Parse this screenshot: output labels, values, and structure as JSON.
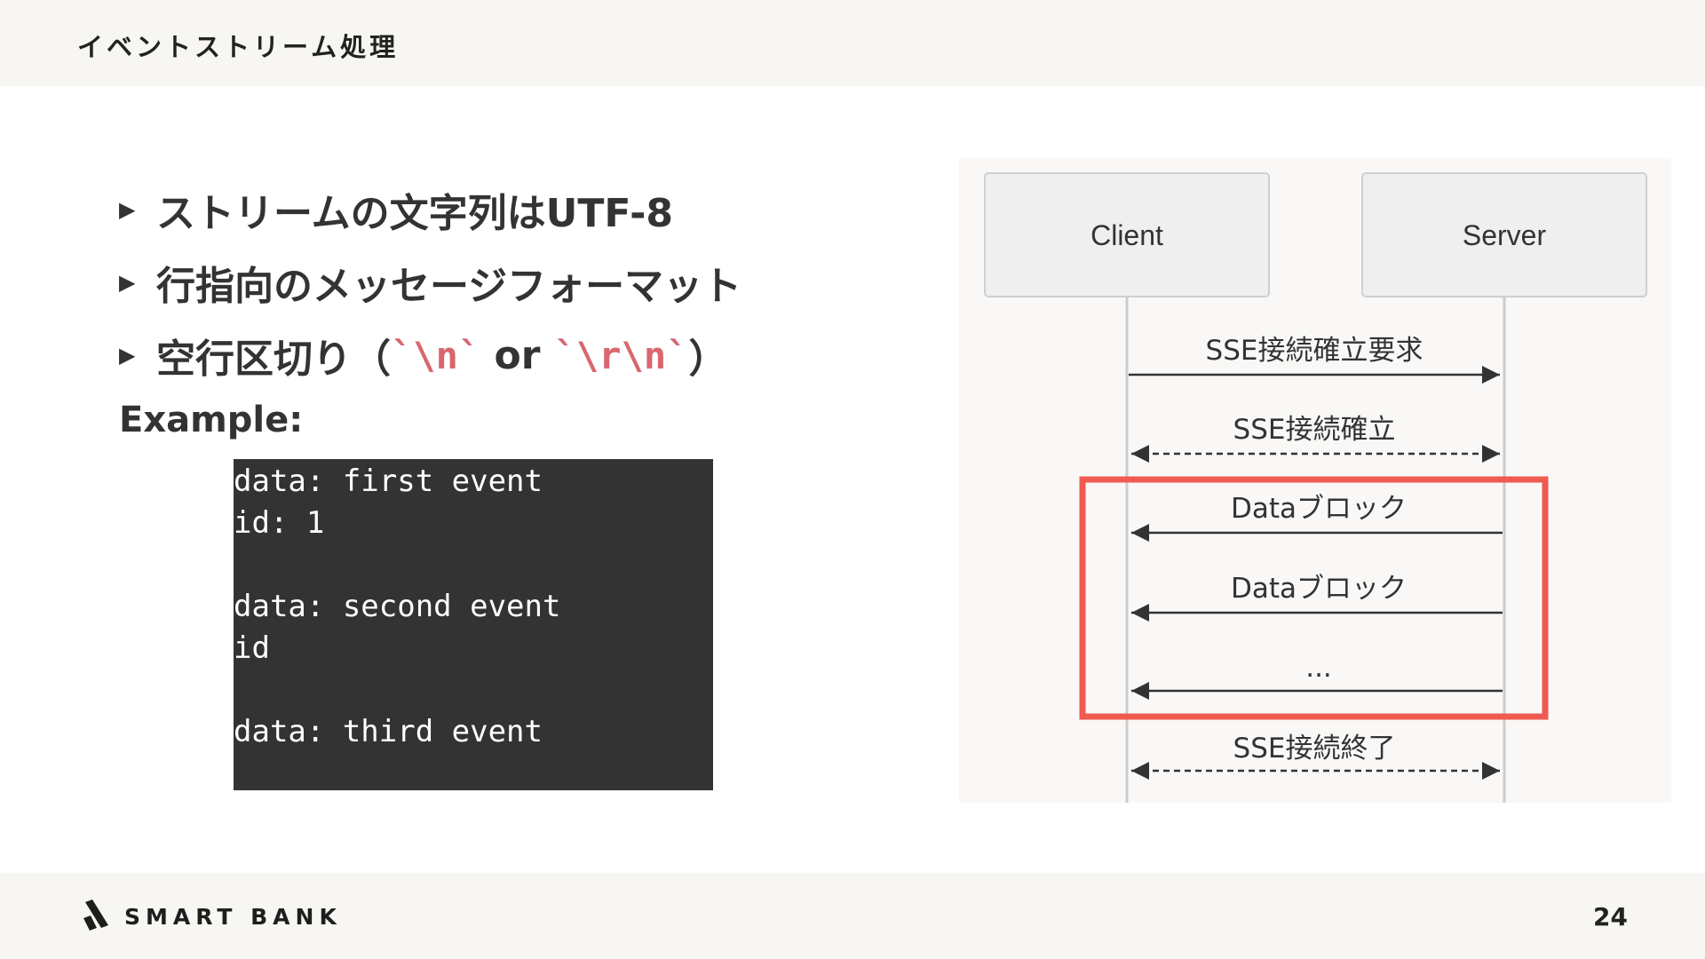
{
  "header": {
    "title": "イベントストリーム処理"
  },
  "bullets": [
    {
      "text": "ストリームの文字列はUTF-8"
    },
    {
      "text": "行指向のメッセージフォーマット"
    },
    {
      "prefix": "空行区切り（",
      "code1": "`\\n`",
      "middle": " or ",
      "code2": "`\\r\\n`",
      "suffix": "）"
    }
  ],
  "example_label": "Example:",
  "code_lines": [
    "data: first event",
    "id: 1",
    "",
    "data: second event",
    "id",
    "",
    "data: third event"
  ],
  "diagram": {
    "participants": [
      "Client",
      "Server"
    ],
    "messages": [
      {
        "label": "SSE接続確立要求",
        "direction": "client-to-server",
        "style": "solid"
      },
      {
        "label": "SSE接続確立",
        "direction": "both",
        "style": "dashed"
      },
      {
        "label": "Dataブロック",
        "direction": "server-to-client",
        "style": "solid",
        "highlighted": true
      },
      {
        "label": "Dataブロック",
        "direction": "server-to-client",
        "style": "solid",
        "highlighted": true
      },
      {
        "label": "...",
        "direction": "server-to-client",
        "style": "solid",
        "highlighted": true
      },
      {
        "label": "SSE接続終了",
        "direction": "both",
        "style": "dashed"
      }
    ],
    "highlight_color": "#f05a50"
  },
  "footer": {
    "logo_text": "SMART BANK",
    "page_number": "24"
  },
  "icons": {
    "bullet": "triangle-right-icon",
    "logo": "smartbank-slash-icon"
  }
}
